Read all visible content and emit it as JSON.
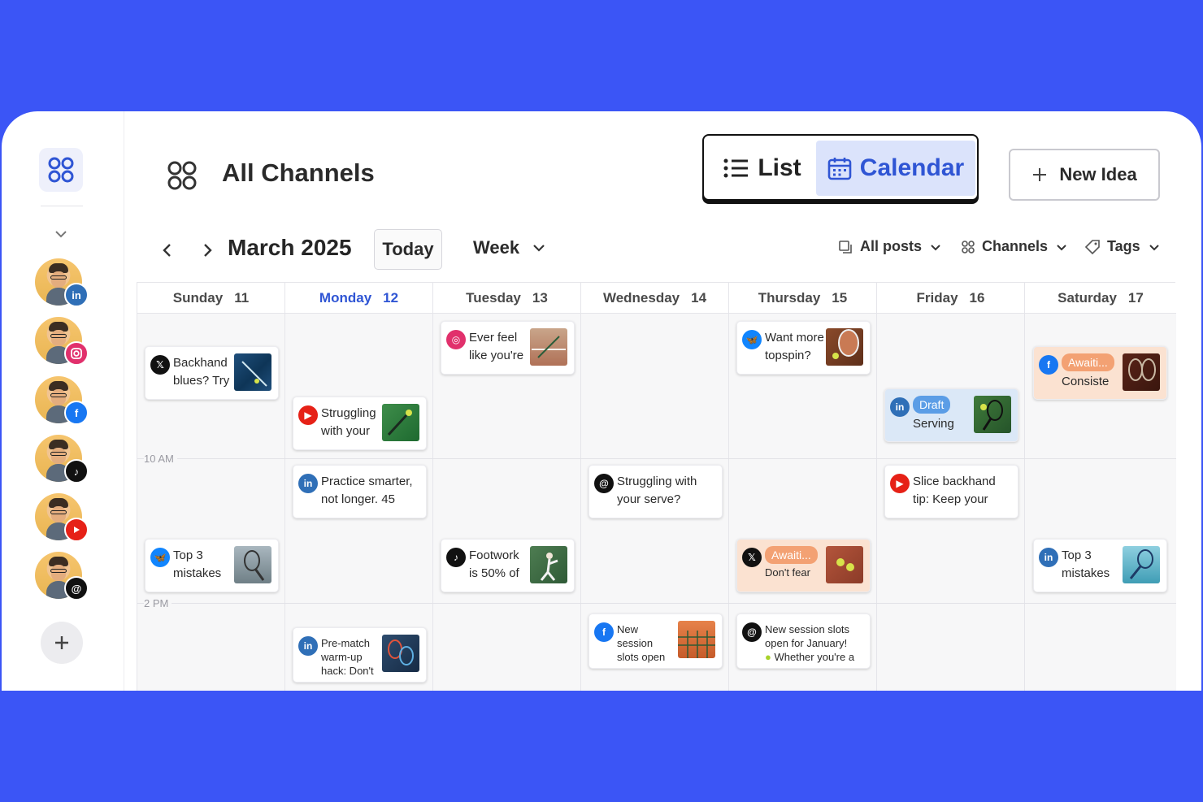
{
  "header": {
    "title": "All Channels",
    "view_list": "List",
    "view_calendar": "Calendar",
    "new_idea": "New Idea"
  },
  "toolbar": {
    "month": "March 2025",
    "today": "Today",
    "range": "Week",
    "filter_posts": "All posts",
    "filter_channels": "Channels",
    "filter_tags": "Tags"
  },
  "days": [
    {
      "name": "Sunday",
      "date": "11"
    },
    {
      "name": "Monday",
      "date": "12"
    },
    {
      "name": "Tuesday",
      "date": "13"
    },
    {
      "name": "Wednesday",
      "date": "14"
    },
    {
      "name": "Thursday",
      "date": "15"
    },
    {
      "name": "Friday",
      "date": "16"
    },
    {
      "name": "Saturday",
      "date": "17"
    }
  ],
  "times": {
    "t10": "10 AM",
    "t14": "2 PM"
  },
  "networks": {
    "linkedin": "#2f6fb7",
    "instagram": "#e1306c",
    "facebook": "#1877f2",
    "tiktok": "#111111",
    "youtube": "#e62117",
    "threads": "#111111",
    "x": "#111111",
    "bluesky": "#1185fe"
  },
  "posts": {
    "p1": {
      "line1": "Backhand",
      "line2": "blues? Try"
    },
    "p2": {
      "line1": "Struggling",
      "line2": "with your"
    },
    "p3": {
      "line1": "Practice smarter,",
      "line2": "not longer. 45"
    },
    "p4": {
      "line1": "Top 3",
      "line2": "mistakes"
    },
    "p5": {
      "line1": "Pre-match",
      "line2": "warm-up",
      "line3": "hack: Don't"
    },
    "p6": {
      "line1": "Ever feel",
      "line2": "like you're"
    },
    "p7": {
      "line1": "Footwork",
      "line2": "is 50% of"
    },
    "p8": {
      "line1": "Struggling with",
      "line2": "your serve?"
    },
    "p9": {
      "line1": "New",
      "line2": "session",
      "line3": "slots open"
    },
    "p10": {
      "line1": "Want more",
      "line2": "topspin?"
    },
    "p11": {
      "badge": "Awaiti...",
      "line2": "Don't fear"
    },
    "p12": {
      "line1": "New session slots",
      "line2": "open for January!",
      "line3": "Whether you're a"
    },
    "p13": {
      "badge": "Draft",
      "line2": "Serving"
    },
    "p14": {
      "line1": "Slice backhand",
      "line2": "tip: Keep your"
    },
    "p15": {
      "badge": "Awaiti...",
      "line2": "Consiste"
    },
    "p16": {
      "line1": "Top 3",
      "line2": "mistakes"
    }
  }
}
